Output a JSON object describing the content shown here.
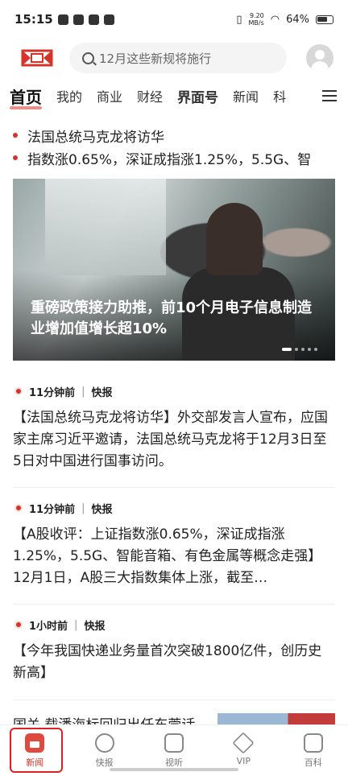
{
  "status_bar": {
    "time": "15:15",
    "net_speed_value": "9.20",
    "net_speed_unit": "MB/s",
    "battery": "64%"
  },
  "header": {
    "search_placeholder": "12月这些新规将施行"
  },
  "tabs": [
    "首页",
    "我的",
    "商业",
    "财经",
    "界面号",
    "新闻",
    "科"
  ],
  "tickers": [
    "法国总统马克龙将访华",
    "指数涨0.65%，深证成指涨1.25%，5.5G、智"
  ],
  "banner": {
    "title": "重磅政策接力助推，前10个月电子信息制造业增加值增长超10%"
  },
  "news": [
    {
      "time": "11分钟前",
      "tag": "快报",
      "text": "【法国总统马克龙将访华】外交部发言人宣布，应国家主席习近平邀请，法国总统马克龙将于12月3日至5日对中国进行国事访问。"
    },
    {
      "time": "11分钟前",
      "tag": "快报",
      "text": "【A股收评：上证指数涨0.65%，深证成指涨1.25%，5.5G、智能音箱、有色金属等概念走强】12月1日，A股三大指数集体上涨，截至…"
    },
    {
      "time": "1小时前",
      "tag": "快报",
      "text": "【今年我国快递业务量首次突破1800亿件，创历史新高】"
    }
  ],
  "partial_item": "国关 载潘海标回归出任东莞话",
  "bottom_nav": [
    "新闻",
    "快报",
    "视听",
    "VIP",
    "百科"
  ],
  "colors": {
    "accent": "#d6342a"
  }
}
